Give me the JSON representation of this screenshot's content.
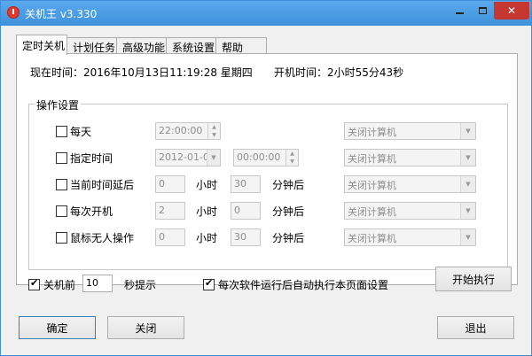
{
  "window": {
    "title": "关机王 v3.330"
  },
  "tabs": [
    {
      "label": "定时关机",
      "active": true
    },
    {
      "label": "计划任务",
      "active": false
    },
    {
      "label": "高级功能",
      "active": false
    },
    {
      "label": "系统设置",
      "active": false
    },
    {
      "label": "帮助",
      "active": false
    }
  ],
  "status": {
    "current_time_label": "现在时间：2016年10月13日11:19:28 星期四",
    "uptime_label": "开机时间：2小时55分43秒"
  },
  "group": {
    "title": "操作设置",
    "rows": [
      {
        "label": "每天",
        "checked": false,
        "time": "22:00:00",
        "action": "关闭计算机"
      },
      {
        "label": "指定时间",
        "checked": false,
        "date": "2012-01-01",
        "time": "00:00:00",
        "action": "关闭计算机"
      },
      {
        "label": "当前时间延后",
        "checked": false,
        "hours": "0",
        "hours_unit": "小时",
        "minutes": "30",
        "minutes_unit": "分钟后",
        "action": "关闭计算机"
      },
      {
        "label": "每次开机",
        "checked": false,
        "hours": "2",
        "hours_unit": "小时",
        "minutes": "0",
        "minutes_unit": "分钟后",
        "action": "关闭计算机"
      },
      {
        "label": "鼠标无人操作",
        "checked": false,
        "hours": "0",
        "hours_unit": "小时",
        "minutes": "30",
        "minutes_unit": "分钟后",
        "action": "关闭计算机"
      }
    ]
  },
  "notify": {
    "label": "关机前",
    "checked": true,
    "seconds": "10",
    "suffix": "秒提示"
  },
  "autorun": {
    "label": "每次软件运行后自动执行本页面设置",
    "checked": true
  },
  "buttons": {
    "start": "开始执行",
    "ok": "确定",
    "close": "关闭",
    "exit": "退出"
  }
}
